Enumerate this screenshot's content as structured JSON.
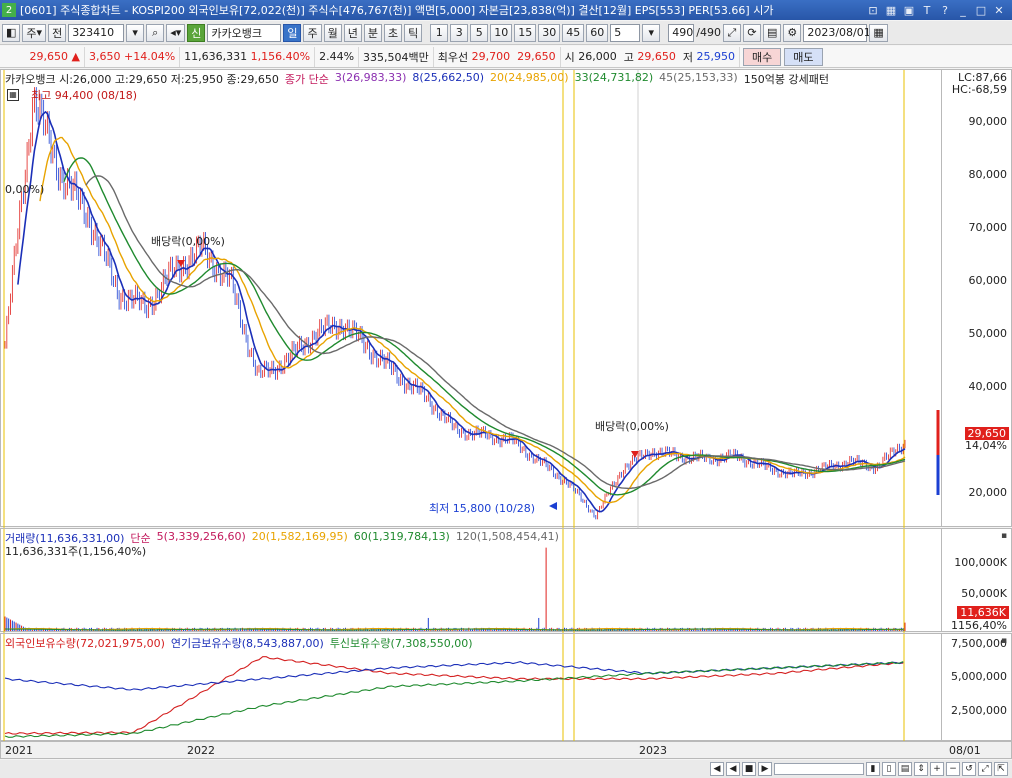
{
  "window": {
    "number": "2",
    "title": "[0601] 주식종합차트 - KOSPI200 외국인보유[72,022(천)] 주식수[476,767(천)] 액면[5,000] 자본금[23,838(억)] 결산[12월] EPS[553] PER[53.66] 시가"
  },
  "toolbar": {
    "type_select": "주",
    "prev_label": "전",
    "code": "323410",
    "credit_label": "신",
    "stock_name": "카카오뱅크",
    "periods": [
      "일",
      "주",
      "월",
      "년",
      "분",
      "초",
      "틱"
    ],
    "active_period": "일",
    "intervals": [
      "1",
      "3",
      "5",
      "10",
      "15",
      "30",
      "45",
      "60"
    ],
    "interval_value": "5",
    "count": "490",
    "count_total": "/490",
    "date": "2023/08/01"
  },
  "quote": {
    "price": "29,650",
    "change": "3,650",
    "change_pct": "+14.04%",
    "volume": "11,636,331",
    "volume_pct": "1,156.40%",
    "turnover_pct": "2.44%",
    "amount": "335,504백만",
    "best_ask_label": "최우선",
    "best_ask": "29,700",
    "best_bid": "29,650",
    "open_label": "시",
    "open": "26,000",
    "high_label": "고",
    "high": "29,650",
    "low_label": "저",
    "low": "25,950",
    "buy_label": "매수",
    "sell_label": "매도"
  },
  "price_panel": {
    "ohlc_label": "카카오뱅크 시:26,000 고:29,650 저:25,950 종:29,650",
    "ma_label": "종가 단순",
    "ma": [
      {
        "text": "3(26,983,33)",
        "color": "#8b2fb0"
      },
      {
        "text": "8(25,662,50)",
        "color": "#1b2fb8"
      },
      {
        "text": "20(24,985,00)",
        "color": "#e8a300"
      },
      {
        "text": "33(24,731,82)",
        "color": "#1f8a2e"
      },
      {
        "text": "45(25,153,33)",
        "color": "#6a6a6a"
      }
    ],
    "pattern_label": "150억봉 강세패턴",
    "lc": "LC:87,66",
    "hc": "HC:-68,59",
    "ticks": [
      "90,000",
      "80,000",
      "70,000",
      "60,000",
      "50,000",
      "40,000",
      "30,000",
      "20,000"
    ],
    "current_price": "29,650",
    "current_pct": "14,04%",
    "high_note": "최고 94,400 (08/18)",
    "low_note": "최저 15,800 (10/28)",
    "dividend_note_1": "배당락(0,00%)",
    "dividend_note_2": "배당락(0,00%)",
    "left_note": "0,00%)"
  },
  "volume_panel": {
    "label": "거래량(11,636,331,00)",
    "ma_label": "단순",
    "ma": [
      {
        "text": "5(3,339,256,60)",
        "color": "#c2185b"
      },
      {
        "text": "20(1,582,169,95)",
        "color": "#e8a300"
      },
      {
        "text": "60(1,319,784,13)",
        "color": "#1f8a2e"
      },
      {
        "text": "120(1,508,454,41)",
        "color": "#6a6a6a"
      }
    ],
    "sub_label": "11,636,331주(1,156,40%)",
    "ticks": [
      "100,000K",
      "50,000K"
    ],
    "current": "11,636K",
    "current_pct": "1156,40%"
  },
  "holding_panel": {
    "series": [
      {
        "text": "외국인보유수량(72,021,975,00)",
        "color": "#d42020"
      },
      {
        "text": "연기금보유수량(8,543,887,00)",
        "color": "#1b2fb8"
      },
      {
        "text": "투신보유수량(7,308,550,00)",
        "color": "#1f8a2e"
      }
    ],
    "ticks": [
      "7,500,000",
      "5,000,000",
      "2,500,000"
    ]
  },
  "dates": {
    "y2021": "2021",
    "y2022": "2022",
    "y2023": "2023",
    "cursor": "08/01"
  },
  "chart_data": {
    "type": "line",
    "title": "카카오뱅크",
    "ylim": [
      15000,
      96000
    ],
    "x_years": [
      "2021",
      "2022",
      "2023"
    ],
    "close_approx": [
      48000,
      94400,
      80000,
      72000,
      58000,
      55000,
      62000,
      66000,
      60000,
      42000,
      45000,
      50000,
      52000,
      47000,
      42000,
      38000,
      32000,
      31000,
      30000,
      26000,
      22000,
      15800,
      25000,
      28000,
      27000,
      26500,
      27000,
      25000,
      23500,
      24500,
      26000,
      25000,
      29650
    ],
    "high_point": {
      "value": 94400,
      "date": "08/18"
    },
    "low_point": {
      "value": 15800,
      "date": "10/28"
    },
    "volume_peak_k": 115000,
    "holding_series": [
      {
        "name": "외국인보유수량",
        "values": [
          500000,
          600000,
          7500000,
          6000000,
          5500000,
          5500000,
          6000000,
          7000000
        ]
      },
      {
        "name": "연기금보유수량",
        "values": [
          5500000,
          4500000,
          5500000,
          6500000,
          7000000,
          6000000,
          6500000,
          7000000
        ]
      },
      {
        "name": "투신보유수량",
        "values": [
          200000,
          500000,
          3000000,
          4800000,
          5300000,
          6000000,
          6500000,
          7000000
        ]
      }
    ]
  }
}
